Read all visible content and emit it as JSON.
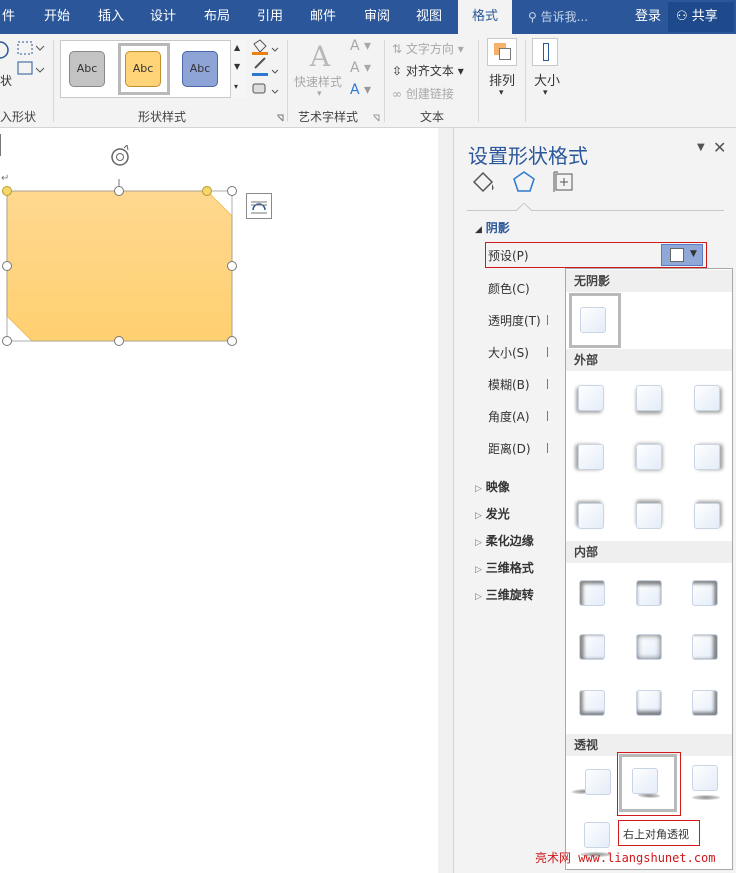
{
  "tabs": [
    "件",
    "开始",
    "插入",
    "设计",
    "布局",
    "引用",
    "邮件",
    "审阅",
    "视图",
    "格式"
  ],
  "tell_me": "告诉我...",
  "login": "登录",
  "share": "共享",
  "ribbon": {
    "insert_shapes_label": "入形状",
    "shape_styles_label": "形状样式",
    "style_swatch_text": "Abc",
    "quick_styles": "快速样式",
    "art_text_label": "艺术字样式",
    "text_direction": "文字方向",
    "align_text": "对齐文本",
    "create_link": "创建链接",
    "text_group_label": "文本",
    "arrange": "排列",
    "size": "大小",
    "swatch_colors": [
      "#c3c3c3",
      "#ffd479",
      "#8fa4d6"
    ]
  },
  "pane": {
    "title": "设置形状格式",
    "section_shadow": "阴影",
    "preset": "预设(P)",
    "color": "颜色(C)",
    "transparency": "透明度(T)",
    "size": "大小(S)",
    "blur": "模糊(B)",
    "angle": "角度(A)",
    "distance": "距离(D)",
    "reflection": "映像",
    "glow": "发光",
    "soft_edges": "柔化边缘",
    "format_3d": "三维格式",
    "rotation_3d": "三维旋转"
  },
  "dropdown": {
    "no_shadow": "无阴影",
    "outer": "外部",
    "inner": "内部",
    "perspective": "透视",
    "tooltip": "右上对角透视"
  },
  "watermark": "亮术网 www.liangshunet.com",
  "shape_color": "#ffd479",
  "accent": "#2b579a"
}
